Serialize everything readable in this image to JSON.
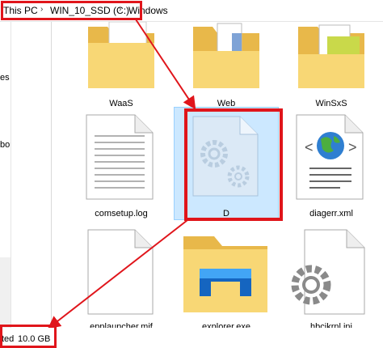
{
  "address": {
    "crumbs": [
      "This PC",
      "WIN_10_SSD (C:)",
      "Windows"
    ]
  },
  "nav": {
    "fragment_1": "es",
    "fragment_2": "bout"
  },
  "files": [
    {
      "name": "WaaS",
      "icon": "folder-icon"
    },
    {
      "name": "Web",
      "icon": "folder-icon"
    },
    {
      "name": "WinSxS",
      "icon": "folder-icon"
    },
    {
      "name": "comsetup.log",
      "icon": "text-file-icon"
    },
    {
      "name": "D",
      "icon": "system-file-icon",
      "selected": true
    },
    {
      "name": "diagerr.xml",
      "icon": "xml-file-icon"
    },
    {
      "name": "epplauncher.mif",
      "icon": "blank-file-icon"
    },
    {
      "name": "explorer.exe",
      "icon": "explorer-folder-icon"
    },
    {
      "name": "hbcikrnl.ini",
      "icon": "settings-file-icon"
    }
  ],
  "status": {
    "prefix": "ted",
    "size": "10.0 GB"
  },
  "colors": {
    "highlight_red": "#e0151b",
    "selection_blue": "#cce8ff",
    "folder_yellow": "#f8d775"
  }
}
